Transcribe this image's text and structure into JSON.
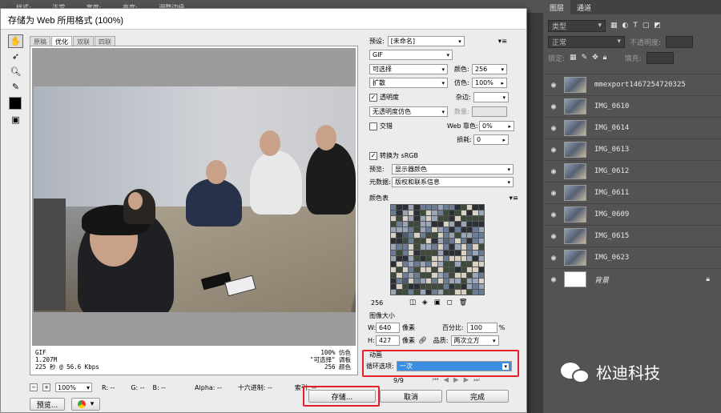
{
  "ps_topbar": [
    "",
    "样式:",
    "正常",
    "宽度:",
    "高度:",
    "调整边缘"
  ],
  "dialog": {
    "title": "存储为 Web 所用格式 (100%)",
    "tabs": [
      "原稿",
      "优化",
      "双联",
      "四联"
    ],
    "info_left": [
      "GIF",
      "1.207M",
      "225 秒 @ 56.6 Kbps"
    ],
    "info_right": [
      "100% 仿色",
      "\"可选择\" 调板",
      "256 颜色"
    ],
    "status": {
      "zoom": "100%",
      "r": "R: --",
      "g": "G: --",
      "b": "B: --",
      "alpha": "Alpha: --",
      "hex": "十六进制: --",
      "index": "索引: --"
    },
    "buttons": {
      "preview": "预览...",
      "save": "存储...",
      "cancel": "取消",
      "done": "完成"
    }
  },
  "settings": {
    "preset_label": "预设:",
    "preset_value": "[未命名]",
    "format": "GIF",
    "reduction": "可选择",
    "colors_label": "颜色:",
    "colors_value": "256",
    "dither_algo": "扩散",
    "dither_label": "仿色:",
    "dither_value": "100%",
    "transparency_label": "透明度",
    "matte_label": "杂边:",
    "trans_dither": "无透明度仿色",
    "amount_label": "数量:",
    "interlaced_label": "交错",
    "web_snap_label": "Web 靠色:",
    "web_snap_value": "0%",
    "lossy_label": "损耗:",
    "lossy_value": "0",
    "convert_srgb_label": "转换为 sRGB",
    "preview_label": "预览:",
    "preview_value": "显示器颜色",
    "metadata_label": "元数据:",
    "metadata_value": "版权和联系信息",
    "color_table_label": "颜色表",
    "color_count": "256",
    "image_size_label": "图像大小",
    "w_label": "W:",
    "w_value": "640",
    "h_label": "H:",
    "h_value": "427",
    "px": "像素",
    "percent_label": "百分比:",
    "percent_value": "100",
    "quality_label": "品质:",
    "quality_value": "两次立方",
    "animation_label": "动画",
    "loop_label": "循环选项:",
    "loop_value": "一次",
    "frame": "9/9"
  },
  "layers_panel": {
    "tabs": [
      "图层",
      "通道"
    ],
    "kind": "类型",
    "blend": "正常",
    "opacity_label": "不透明度:",
    "lock_label": "锁定:",
    "fill_label": "填充:",
    "layers": [
      "mmexport1467254720325",
      "IMG_0610",
      "IMG_0614",
      "IMG_0613",
      "IMG_0612",
      "IMG_0611",
      "IMG_0609",
      "IMG_0615",
      "IMG_0623",
      "背景"
    ]
  },
  "watermark": "松迪科技",
  "colors": {
    "highlight": "#e4202a",
    "loop_select": "#3a8fe0"
  }
}
